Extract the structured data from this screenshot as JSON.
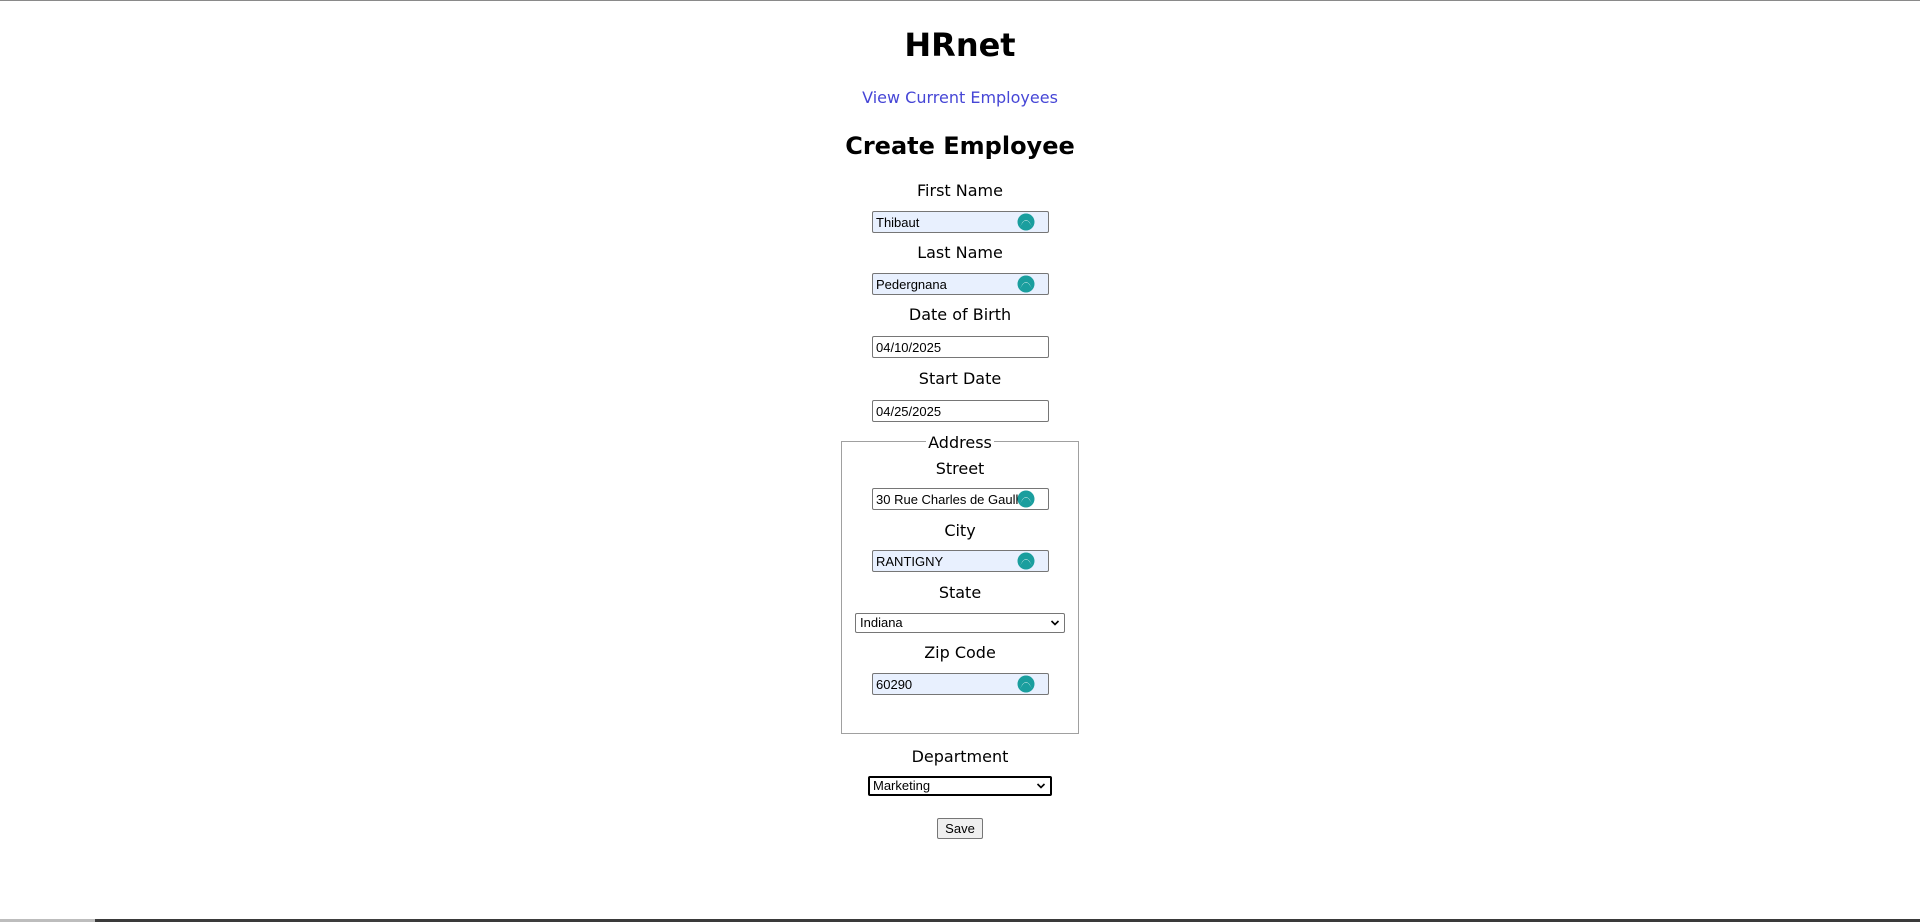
{
  "app": {
    "title": "HRnet",
    "nav_link": "View Current Employees"
  },
  "form": {
    "heading": "Create Employee",
    "first_name": {
      "label": "First Name",
      "value": "Thibaut"
    },
    "last_name": {
      "label": "Last Name",
      "value": "Pedergnana"
    },
    "date_of_birth": {
      "label": "Date of Birth",
      "value": "04/10/2025"
    },
    "start_date": {
      "label": "Start Date",
      "value": "04/25/2025"
    },
    "address": {
      "legend": "Address",
      "street": {
        "label": "Street",
        "value": "30 Rue Charles de Gaulle"
      },
      "city": {
        "label": "City",
        "value": "RANTIGNY"
      },
      "state": {
        "label": "State",
        "selected": "Indiana"
      },
      "zip": {
        "label": "Zip Code",
        "value": "60290"
      }
    },
    "department": {
      "label": "Department",
      "selected": "Marketing"
    },
    "save_label": "Save"
  },
  "colors": {
    "link": "#4646d6",
    "autofill_bg": "#e8f0fe",
    "password_manager_icon": "#1a9e9e"
  },
  "icons": {
    "password_manager": "password-manager-icon",
    "select_arrow": "chevron-down-icon"
  }
}
